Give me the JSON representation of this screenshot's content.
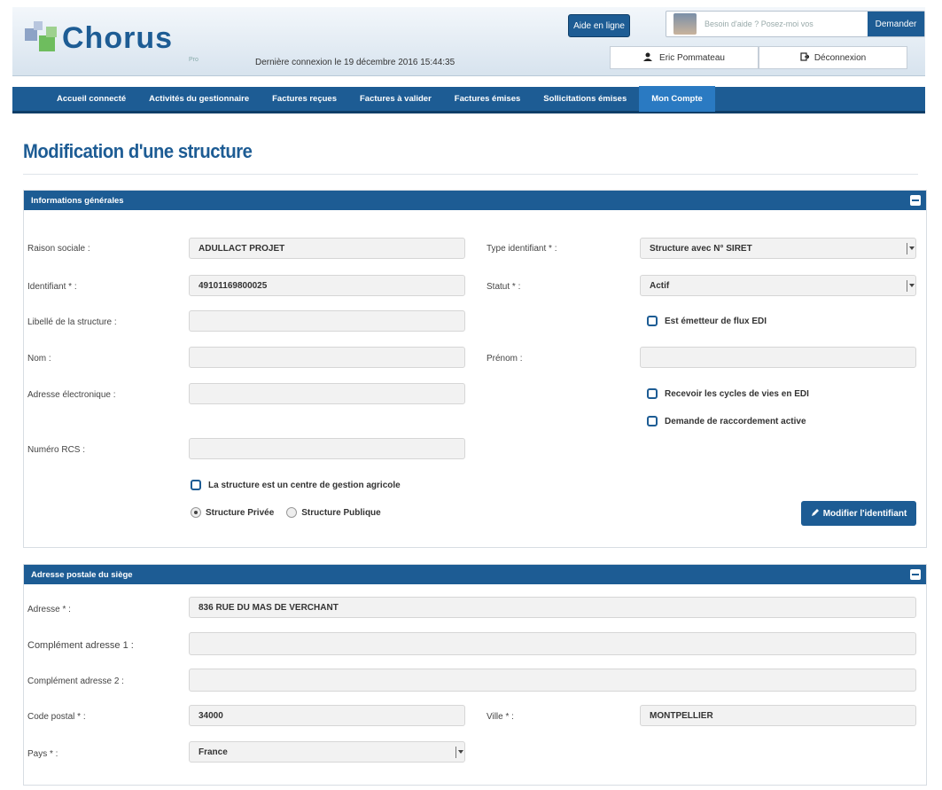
{
  "header": {
    "topcut": "",
    "logo_word": "Chorus",
    "logo_sub": "Pro",
    "last_login": "Dernière connexion le 19 décembre 2016 15:44:35",
    "help_online": "Aide en ligne",
    "help_placeholder": "Besoin d'aide ? Posez-moi vos",
    "ask_button": "Demander",
    "user_name": "Eric Pommateau",
    "logout": "Déconnexion"
  },
  "nav": {
    "items": [
      "Accueil connecté",
      "Activités du gestionnaire",
      "Factures reçues",
      "Factures à valider",
      "Factures émises",
      "Sollicitations émises",
      "Mon Compte"
    ],
    "active_index": 6
  },
  "page": {
    "title": "Modification d'une structure"
  },
  "general": {
    "title": "Informations générales",
    "raison_sociale_label": "Raison sociale :",
    "raison_sociale_value": "ADULLACT PROJET",
    "type_identifiant_label": "Type identifiant * :",
    "type_identifiant_value": "Structure avec N° SIRET",
    "identifiant_label": "Identifiant * :",
    "identifiant_value": "49101169800025",
    "statut_label": "Statut * :",
    "statut_value": "Actif",
    "libelle_label": "Libellé de la structure :",
    "libelle_value": "",
    "emetteur_edi_label": "Est émetteur de flux EDI",
    "nom_label": "Nom :",
    "nom_value": "",
    "prenom_label": "Prénom :",
    "prenom_value": "",
    "email_label": "Adresse électronique :",
    "email_value": "",
    "cycles_edi_label": "Recevoir les cycles de vies en EDI",
    "raccordement_label": "Demande de raccordement active",
    "rcs_label": "Numéro RCS :",
    "rcs_value": "",
    "agricole_label": "La structure est un centre de gestion agricole",
    "radio_privee": "Structure Privée",
    "radio_publique": "Structure Publique",
    "modify_button": "Modifier l'identifiant"
  },
  "address": {
    "title": "Adresse postale du siège",
    "adresse_label": "Adresse * :",
    "adresse_value": "836 RUE DU MAS DE VERCHANT",
    "comp1_label": "Complément adresse 1 :",
    "comp1_value": "",
    "comp2_label": "Complément adresse 2 :",
    "comp2_value": "",
    "cp_label": "Code postal * :",
    "cp_value": "34000",
    "ville_label": "Ville * :",
    "ville_value": "MONTPELLIER",
    "pays_label": "Pays * :",
    "pays_value": "France"
  }
}
